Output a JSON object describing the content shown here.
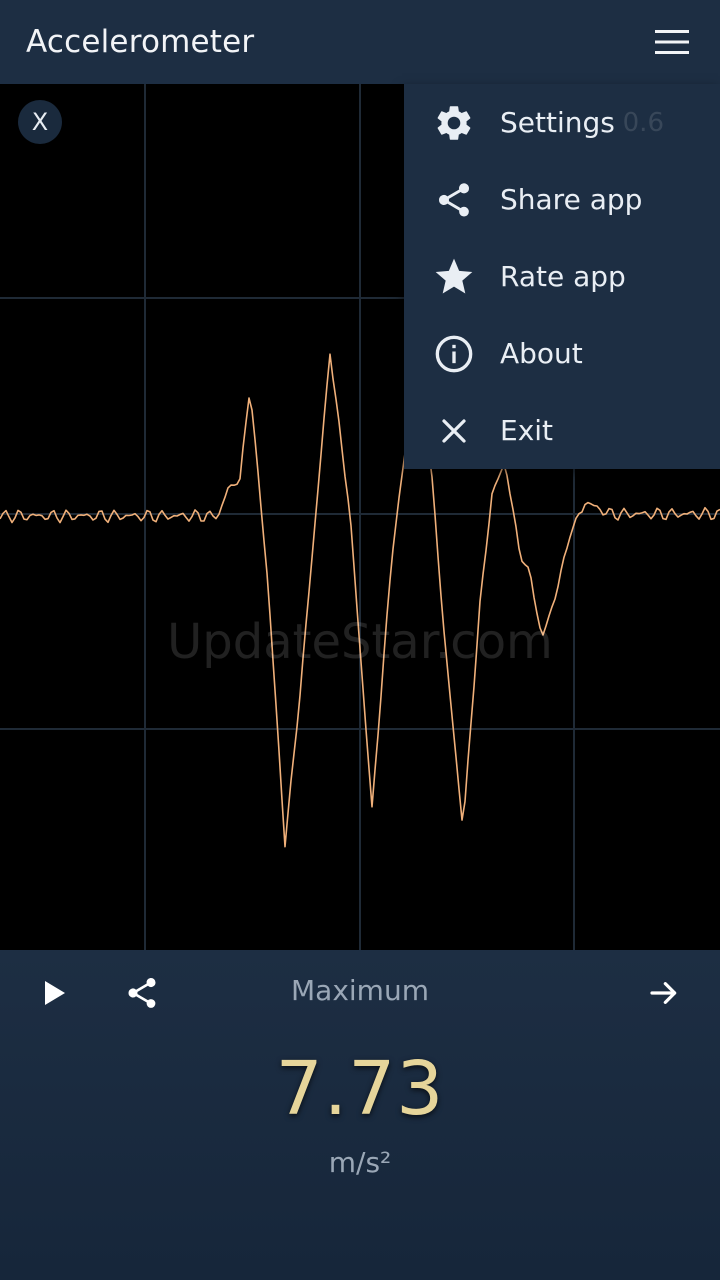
{
  "appbar": {
    "title": "Accelerometer"
  },
  "graph": {
    "close_label": "X",
    "watermark": "UpdateStar.com",
    "faint_value": "0.6"
  },
  "menu": {
    "items": [
      {
        "label": "Settings",
        "icon": "gear-icon"
      },
      {
        "label": "Share app",
        "icon": "share-icon"
      },
      {
        "label": "Rate app",
        "icon": "star-icon"
      },
      {
        "label": "About",
        "icon": "info-icon"
      },
      {
        "label": "Exit",
        "icon": "close-icon"
      }
    ]
  },
  "bottom": {
    "mode_label": "Maximum",
    "value": "7.73",
    "unit": "m/s²"
  },
  "colors": {
    "bar": "#1d2e43",
    "trace": "#f0b07a",
    "reading": "#e6d59a",
    "grid": "#1f2a36"
  }
}
